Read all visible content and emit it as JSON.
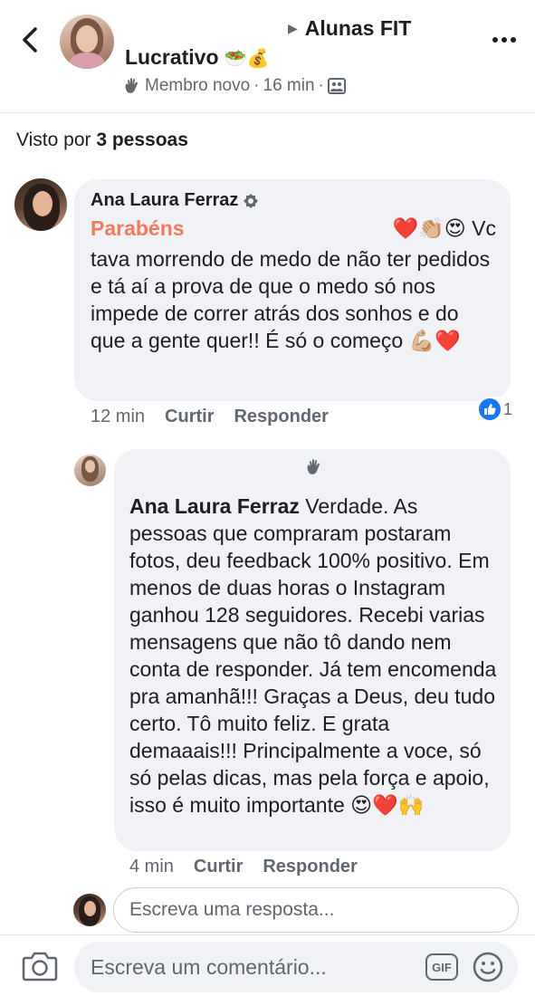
{
  "header": {
    "group": "Alunas FIT",
    "author": "Lucrativo",
    "author_emojis": "🥗💰",
    "member_badge": "Membro novo",
    "time": "16 min",
    "separator": "·"
  },
  "seen": {
    "prefix": "Visto por",
    "count": "3 pessoas"
  },
  "comments": [
    {
      "author": "Ana Laura Ferraz",
      "highlight": "Parabéns",
      "emojis_1": "❤️👏🏼😍",
      "text_1": "Vc",
      "text_2": "tava morrendo de medo de não ter pedidos e tá aí a prova de que o medo só nos impede de correr atrás dos sonhos e do que a gente quer!! É só o começo",
      "emojis_2": "💪🏼❤️",
      "time": "12 min",
      "like_label": "Curtir",
      "reply_label": "Responder",
      "reactions_count": "1"
    },
    {
      "author": "Ana Laura Ferraz",
      "text": "Verdade. As pessoas que compraram postaram fotos, deu feedback 100% positivo. Em menos de duas horas o Instagram ganhou 128 seguidores. Recebi varias mensagens que não tô dando nem conta de responder. Já tem encomenda pra amanhã!!! Graças a Deus, deu tudo certo. Tô muito feliz. E grata demaaais!!! Principalmente a voce, só só pelas dicas, mas pela força e apoio, isso é muito importante",
      "emojis": "😍❤️🙌",
      "time": "4 min",
      "like_label": "Curtir",
      "reply_label": "Responder"
    }
  ],
  "reply_placeholder": "Escreva uma resposta...",
  "footer": {
    "comment_placeholder": "Escreva um comentário...",
    "gif_label": "GIF"
  },
  "colors": {
    "highlight": "#f07c5e",
    "like_blue": "#1877f2",
    "bubble_bg": "#f0f2f5",
    "muted_text": "#606770"
  }
}
